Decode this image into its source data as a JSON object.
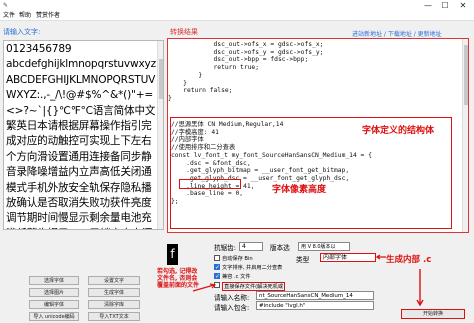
{
  "window": {
    "icon": "app-icon",
    "controls": [
      "—",
      "☐",
      "✕"
    ]
  },
  "menu": [
    "文件",
    "帮助",
    "赞赏作者"
  ],
  "input": {
    "label": "请输入文字:",
    "text": "0123456789\nabcdefghijklmnopqrstuvwxyz\nABCDEFGHIJKLMNOPQRSTUVWXYZ:.,-_/\\!@#$%^&*()\"+=<>?~`|{}℃℉°C语言简体中文繁英日本请根据屏幕操作指引完成对应的动触控可实现上下左右个方向滑设置通用连接备同步静音录降噪增益内立声高低关闭通模式手机外放安全轨保存隐私播放确认是否取消失败功获件亮度调节期时间慢显示剩余量电池充满低警告提示 [一]已锁定由电源键解锁耐心待几分钟"
  },
  "output": {
    "label": "转换结果",
    "link": "进站新地址 / 下载地址 / 更新地址",
    "code_top": "            dsc_out->ofs_x = gdsc->ofs_x;\n            dsc_out->ofs_y = gdsc->ofs_y;\n            dsc_out->bpp = fdsc->bpp;\n            return true;\n        }\n    }\n    return false;\n}",
    "code_bottom": "//思源黑体 CN Medium,Regular,14\n//字模高度: 41\n//内部字体\n//使用排序和二分查表\nconst lv_font_t my_font_SourceHanSansCN_Medium_14 = {\n    .dsc = &font_dsc,\n    .get_glyph_bitmap = __user_font_get_bitmap,\n    .get_glyph_dsc = __user_font_get_glyph_dsc,\n    .line_height = 41,\n    .base_line = 0,\n};",
    "annot_struct": "字体定义的结构体",
    "annot_height": "字体像素高度"
  },
  "preview_char": "f",
  "options": {
    "antialias_label": "抗锯齿:",
    "antialias_value": "4",
    "version_label": "版本选",
    "version_value": "用 V 8.0版本以",
    "type_label": "类型",
    "type_value": "内部字体",
    "checkboxes": [
      {
        "label": "自动保存 Bin",
        "checked": false
      },
      {
        "label": "文字排序, 并启用二分查表",
        "checked": true
      },
      {
        "label": "兼容 .c 文件",
        "checked": true
      },
      {
        "label": "直接保存文件(解决死机或",
        "checked": false
      }
    ],
    "name_label": "请输入名称:",
    "name_value": "nt_SourceHanSansCN_Medium_14",
    "include_label": "请输入包含:",
    "include_value": "#include \"lvgl.h\"",
    "annot_gen": "生成内部 .c",
    "annot_note": "若勾选, 记得改\n文件名, 否则会\n覆盖前面的文件",
    "start_button": "开始转换"
  },
  "left_buttons": [
    "选择字体",
    "设置文字",
    "选择图片",
    "生成字体",
    "编辑字体",
    "清除字库",
    "导入 unicode编码",
    "导入TXT文本"
  ]
}
